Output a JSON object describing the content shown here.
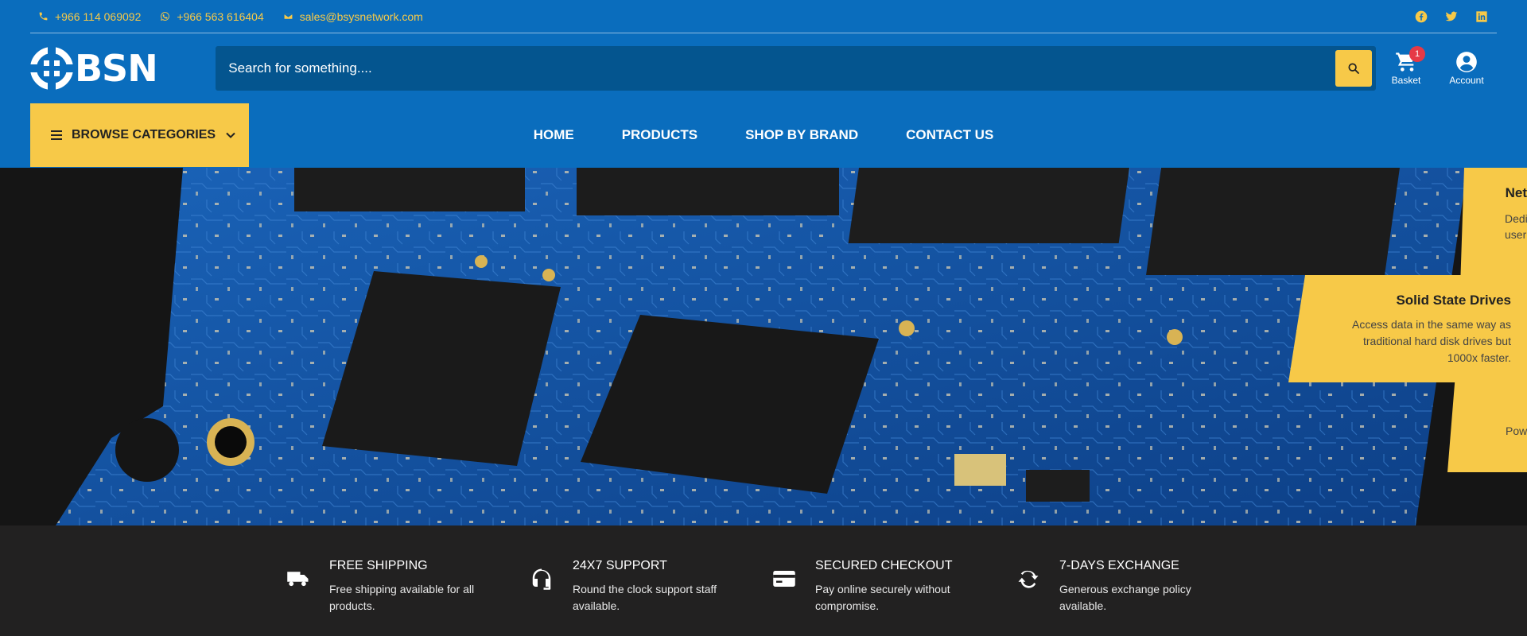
{
  "topbar": {
    "phone": "+966 114 069092",
    "whatsapp": "+966 563 616404",
    "email": "sales@bsysnetwork.com",
    "social": [
      "facebook-icon",
      "twitter-icon",
      "linkedin-icon"
    ]
  },
  "header": {
    "logo_text": "BSN",
    "search_placeholder": "Search for something....",
    "basket_label": "Basket",
    "basket_count": "1",
    "account_label": "Account"
  },
  "nav": {
    "browse_label": "BROWSE CATEGORIES",
    "items": [
      "HOME",
      "PRODUCTS",
      "SHOP BY BRAND",
      "CONTACT US"
    ]
  },
  "hero": {
    "back_card": {
      "title": "Net",
      "text_line1": "Dedica",
      "text_line2": "user",
      "text_bottom": "Pow"
    },
    "front_card": {
      "title": "Solid State Drives",
      "text": "Access data in the same way as traditional hard disk drives but 1000x faster."
    }
  },
  "features": [
    {
      "title": "FREE SHIPPING",
      "desc_line1": "Free shipping available for all",
      "desc_line2": "products.",
      "icon": "truck-icon"
    },
    {
      "title": "24X7 SUPPORT",
      "desc_line1": "Round the clock support staff",
      "desc_line2": "available.",
      "icon": "headset-icon"
    },
    {
      "title": "SECURED CHECKOUT",
      "desc_line1": "Pay online securely without",
      "desc_line2": "compromise.",
      "icon": "credit-card-icon"
    },
    {
      "title": "7-DAYS EXCHANGE",
      "desc_line1": "Generous exchange policy",
      "desc_line2": "available.",
      "icon": "exchange-icon"
    }
  ],
  "colors": {
    "brand_blue": "#0a6dbd",
    "search_blue": "#04558f",
    "accent_yellow": "#f7c948",
    "dark": "#222121",
    "badge_red": "#e63946"
  }
}
